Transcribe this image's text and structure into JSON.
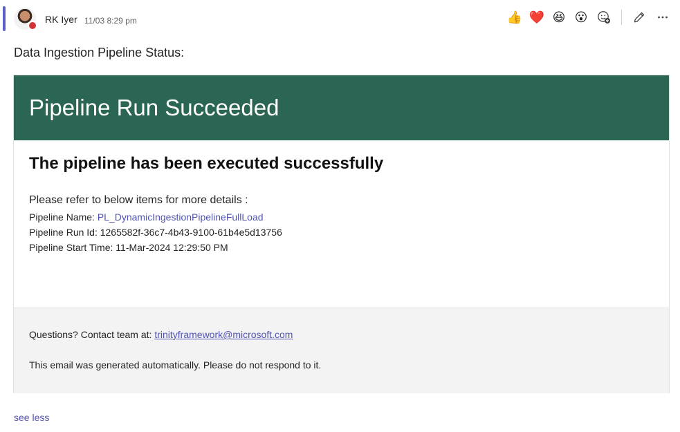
{
  "message": {
    "sender": "RK Iyer",
    "timestamp": "11/03 8:29 pm",
    "title": "Data Ingestion Pipeline Status:",
    "see_less": "see less"
  },
  "reactions": [
    {
      "icon": "thumbs-up-icon",
      "glyph": "👍"
    },
    {
      "icon": "heart-icon",
      "glyph": "❤️"
    },
    {
      "icon": "laugh-icon",
      "glyph": "😆"
    },
    {
      "icon": "surprised-icon",
      "glyph": "😮"
    }
  ],
  "card": {
    "header": "Pipeline Run Succeeded",
    "heading": "The pipeline has been executed successfully",
    "refer_text": "Please refer to below items for more details :",
    "pipeline_name_label": "Pipeline Name: ",
    "pipeline_name_value": "PL_DynamicIngestionPipelineFullLoad",
    "run_id_label": "Pipeline Run Id: ",
    "run_id_value": "1265582f-36c7-4b43-9100-61b4e5d13756",
    "start_time_label": "Pipeline Start Time: ",
    "start_time_value": "11-Mar-2024 12:29:50 PM",
    "footer": {
      "questions_text": "Questions? Contact team at: ",
      "email": "trinityframework@microsoft.com",
      "auto_note": "This email was generated automatically. Please do not respond to it."
    }
  },
  "colors": {
    "header_bg": "#2b6553",
    "accent": "#5b5fc7",
    "link": "#4f52b2",
    "presence_busy": "#d13438"
  }
}
